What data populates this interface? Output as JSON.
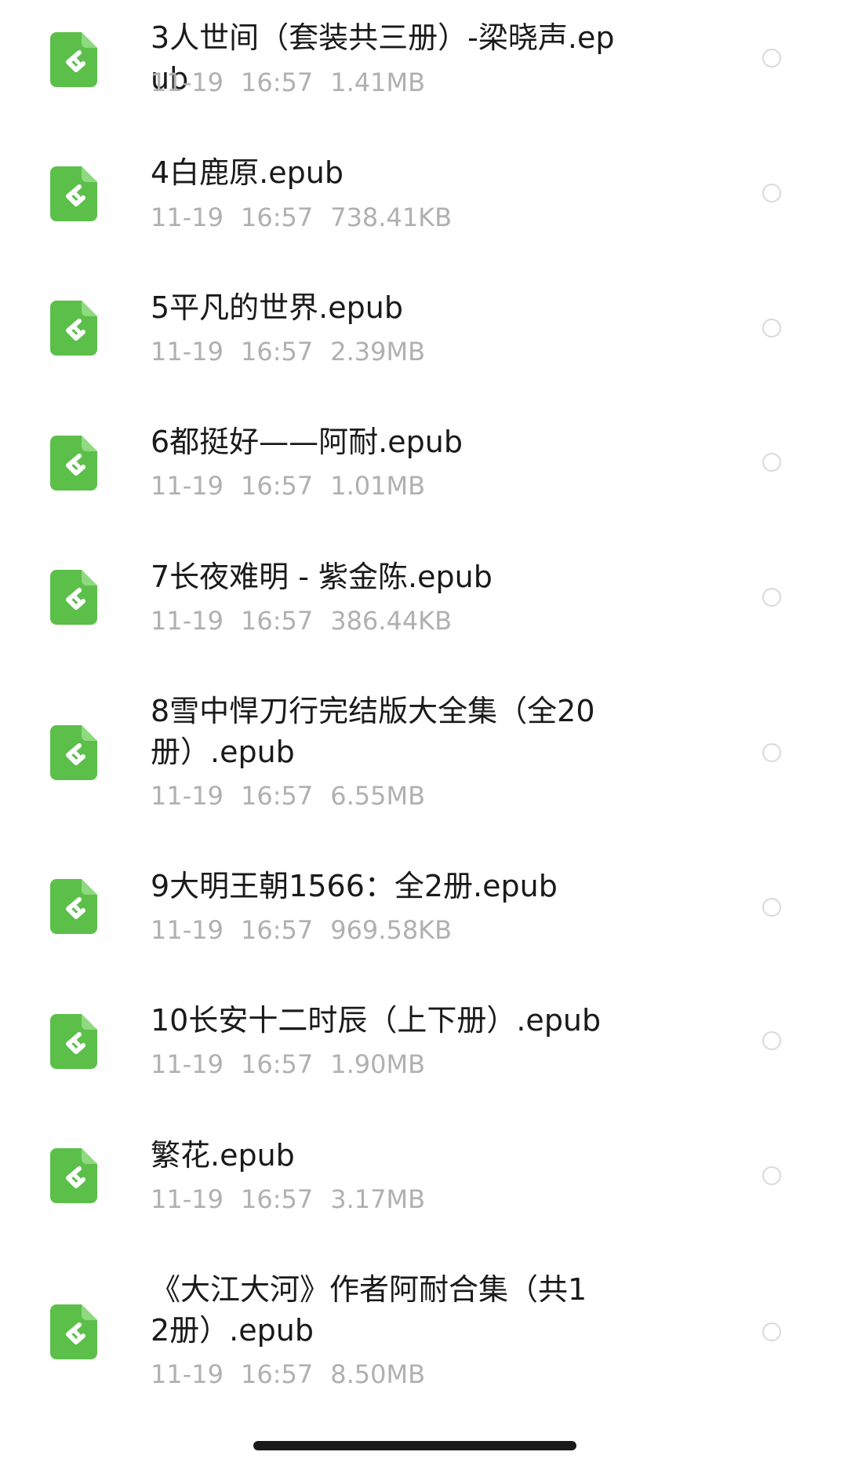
{
  "colors": {
    "icon_green": "#5bbf4a",
    "icon_fold": "#8fd97f",
    "text_primary": "#1a1a1a",
    "text_secondary": "#b0b0b0",
    "radio_border": "#d9d9d9"
  },
  "icon": "epub-file-icon",
  "files": [
    {
      "name": "3人世间（套装共三册）-梁晓声.epub",
      "date": "11-19",
      "time": "16:57",
      "size": "1.41MB"
    },
    {
      "name": "4白鹿原.epub",
      "date": "11-19",
      "time": "16:57",
      "size": "738.41KB"
    },
    {
      "name": "5平凡的世界.epub",
      "date": "11-19",
      "time": "16:57",
      "size": "2.39MB"
    },
    {
      "name": "6都挺好——阿耐.epub",
      "date": "11-19",
      "time": "16:57",
      "size": "1.01MB"
    },
    {
      "name": "7长夜难明 - 紫金陈.epub",
      "date": "11-19",
      "time": "16:57",
      "size": "386.44KB"
    },
    {
      "name": "8雪中悍刀行完结版大全集（全20册）.epub",
      "date": "11-19",
      "time": "16:57",
      "size": "6.55MB"
    },
    {
      "name": "9大明王朝1566：全2册.epub",
      "date": "11-19",
      "time": "16:57",
      "size": "969.58KB"
    },
    {
      "name": "10长安十二时辰（上下册）.epub",
      "date": "11-19",
      "time": "16:57",
      "size": "1.90MB"
    },
    {
      "name": "繁花.epub",
      "date": "11-19",
      "time": "16:57",
      "size": "3.17MB"
    },
    {
      "name": "《大江大河》作者阿耐合集（共12册）.epub",
      "date": "11-19",
      "time": "16:57",
      "size": "8.50MB"
    }
  ]
}
